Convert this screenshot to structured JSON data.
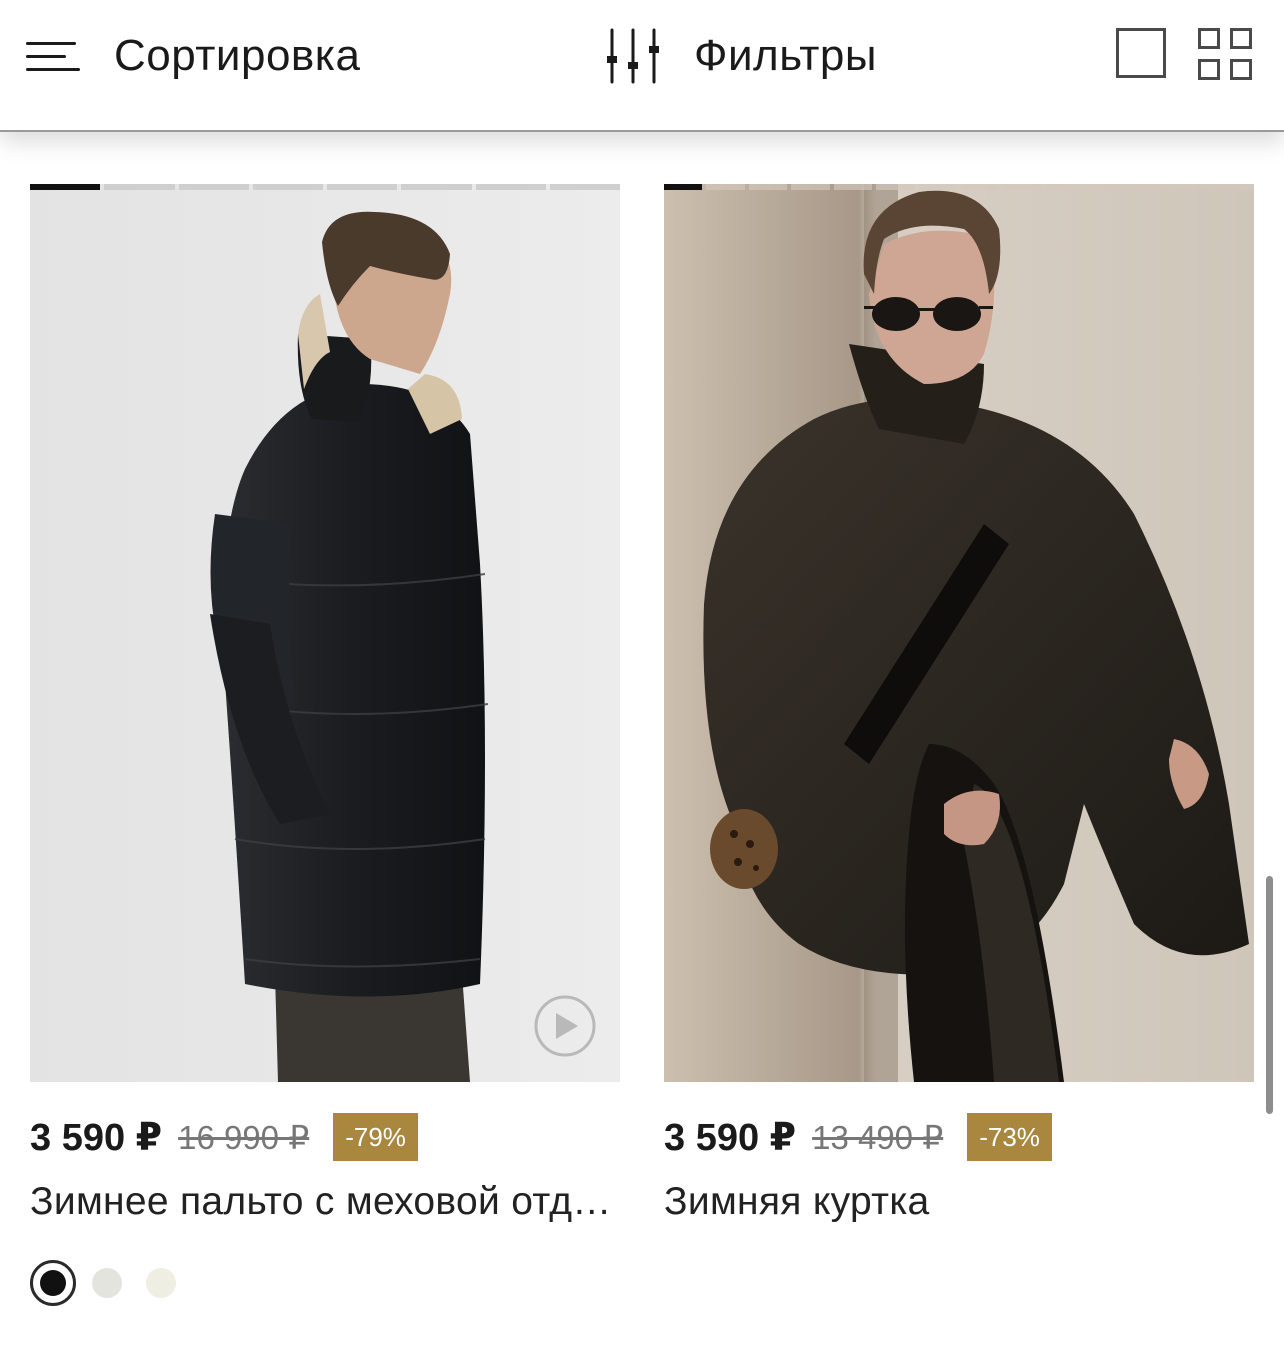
{
  "toolbar": {
    "sort_label": "Сортировка",
    "filter_label": "Фильтры",
    "sort_icon": "menu-lines-icon",
    "filter_icon": "sliders-icon",
    "view_single_icon": "single-view-icon",
    "view_grid_icon": "grid-view-icon"
  },
  "products": [
    {
      "price": "3 590 ₽",
      "old_price": "16 990 ₽",
      "discount": "-79%",
      "title": "Зимнее пальто с меховой отделкой",
      "has_video": true,
      "gallery_total": 8,
      "gallery_current": 1,
      "swatches": [
        "#111111",
        "#e4e4df",
        "#eeeee2"
      ],
      "selected_swatch": 0
    },
    {
      "price": "3 590 ₽",
      "old_price": "13 490 ₽",
      "discount": "-73%",
      "title": "Зимняя куртка",
      "has_video": false,
      "gallery_total": 14,
      "gallery_current": 1,
      "swatches": [],
      "selected_swatch": null
    }
  ],
  "colors": {
    "badge": "#a9873f",
    "text": "#1a1a1a",
    "old_price": "#777777"
  }
}
